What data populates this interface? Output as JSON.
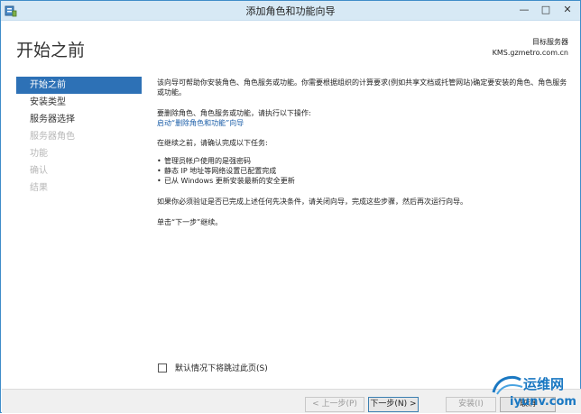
{
  "window": {
    "title": "添加角色和功能向导",
    "minimize_glyph": "—",
    "maximize_glyph": "□",
    "close_glyph": "✕"
  },
  "header": {
    "heading": "开始之前",
    "server_label": "目标服务器",
    "server_name": "KMS.gzmetro.com.cn"
  },
  "nav": {
    "items": [
      {
        "label": "开始之前",
        "state": "active"
      },
      {
        "label": "安装类型",
        "state": "normal"
      },
      {
        "label": "服务器选择",
        "state": "normal"
      },
      {
        "label": "服务器角色",
        "state": "disabled"
      },
      {
        "label": "功能",
        "state": "disabled"
      },
      {
        "label": "确认",
        "state": "disabled"
      },
      {
        "label": "结果",
        "state": "disabled"
      }
    ]
  },
  "content": {
    "intro": "该向导可帮助你安装角色、角色服务或功能。你需要根据组织的计算要求(例如共享文档或托管网站)确定要安装的角色、角色服务或功能。",
    "remove_prompt": "要删除角色、角色服务或功能，请执行以下操作:",
    "remove_link": "启动“删除角色和功能”向导",
    "tasks_prompt": "在继续之前，请确认完成以下任务:",
    "tasks": [
      "管理员帐户使用的是强密码",
      "静态 IP 地址等网络设置已配置完成",
      "已从 Windows 更新安装最新的安全更新"
    ],
    "verify_text": "如果你必须验证是否已完成上述任何先决条件，请关闭向导，完成这些步骤，然后再次运行向导。",
    "continue_text": "单击“下一步”继续。"
  },
  "skip_checkbox": {
    "label": "默认情况下将跳过此页(S)",
    "checked": false
  },
  "footer": {
    "prev_label": "< 上一步(P)",
    "next_label": "下一步(N) >",
    "install_label": "安装(I)",
    "cancel_label": "取消"
  },
  "watermark": {
    "line1": "运维网",
    "line2": "iyunv.com"
  },
  "colors": {
    "accent": "#2d71b6",
    "titlebar": "#d7e9f5",
    "link": "#1b5ea8",
    "watermark": "#1a78c2"
  }
}
